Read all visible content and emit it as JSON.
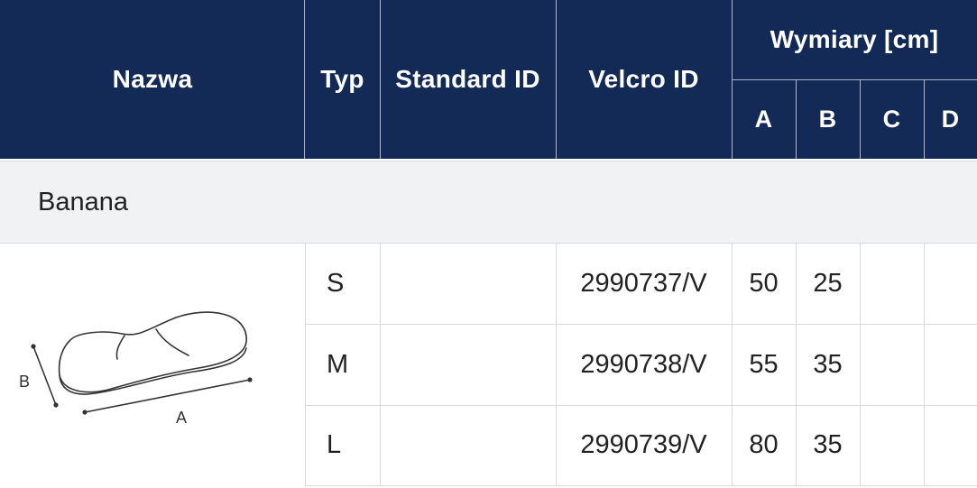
{
  "table": {
    "headers": {
      "name": "Nazwa",
      "type": "Typ",
      "standard_id": "Standard ID",
      "velcro_id": "Velcro ID",
      "dimensions": "Wymiary [cm]",
      "dim_a": "A",
      "dim_b": "B",
      "dim_c": "C",
      "dim_d": "D"
    },
    "group": {
      "name": "Banana",
      "illustration_labels": {
        "a": "A",
        "b": "B"
      }
    },
    "rows": [
      {
        "type": "S",
        "standard_id": "",
        "velcro_id": "2990737/V",
        "a": "50",
        "b": "25",
        "c": "",
        "d": ""
      },
      {
        "type": "M",
        "standard_id": "",
        "velcro_id": "2990738/V",
        "a": "55",
        "b": "35",
        "c": "",
        "d": ""
      },
      {
        "type": "L",
        "standard_id": "",
        "velcro_id": "2990739/V",
        "a": "80",
        "b": "35",
        "c": "",
        "d": ""
      }
    ]
  },
  "colors": {
    "header_bg": "#122a55",
    "header_text": "#ffffff",
    "group_bg": "#f1f2f4",
    "grid_line": "#d7d9dd"
  }
}
